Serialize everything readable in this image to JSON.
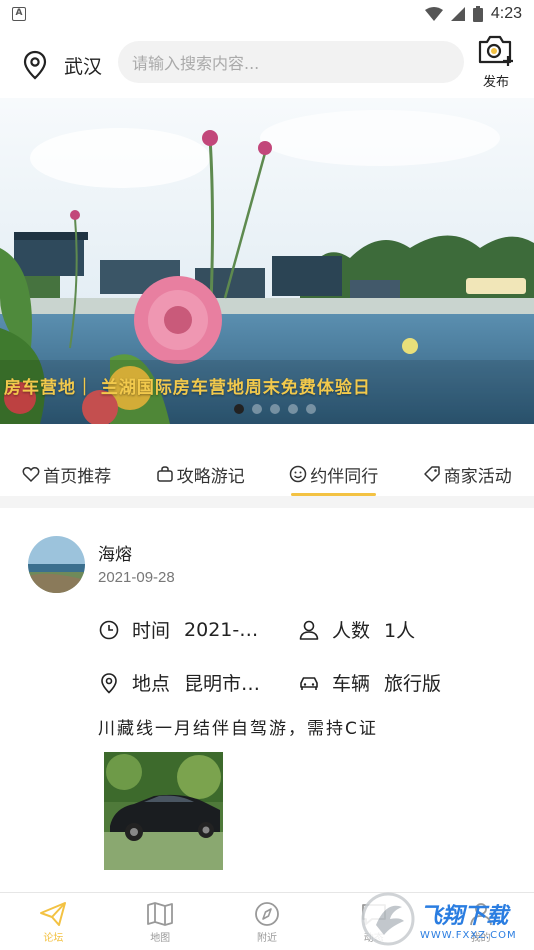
{
  "status_bar": {
    "time": "4:23",
    "left_badge": "A"
  },
  "header": {
    "city": "武汉",
    "search_placeholder": "请输入搜索内容...",
    "publish_label": "发布"
  },
  "banner": {
    "caption": "房车营地｜ 兰湖国际房车营地周末免费体验日",
    "page_count": 5,
    "active_page": 1
  },
  "tabs": [
    {
      "label": "首页推荐",
      "icon": "heart-icon",
      "active": false
    },
    {
      "label": "攻略游记",
      "icon": "bag-icon",
      "active": false
    },
    {
      "label": "约伴同行",
      "icon": "smile-icon",
      "active": true
    },
    {
      "label": "商家活动",
      "icon": "tag-icon",
      "active": false
    }
  ],
  "post": {
    "author": "海熔",
    "date": "2021-09-28",
    "time_label": "时间",
    "time_value": "2021-…",
    "people_label": "人数",
    "people_value": "1人",
    "place_label": "地点",
    "place_value": "昆明市…",
    "vehicle_label": "车辆",
    "vehicle_value": "旅行版",
    "description": "川藏线一月结伴自驾游，需持C证"
  },
  "bottom_nav": [
    {
      "label": "论坛",
      "icon": "paper-plane-icon",
      "active": true
    },
    {
      "label": "地图",
      "icon": "map-icon",
      "active": false
    },
    {
      "label": "附近",
      "icon": "compass-icon",
      "active": false
    },
    {
      "label": "动态",
      "icon": "message-icon",
      "active": false
    },
    {
      "label": "我的",
      "icon": "user-icon",
      "active": false
    }
  ],
  "watermark": {
    "brand": "飞翔下载",
    "url": "WWW.FXXZ.COM"
  },
  "colors": {
    "accent": "#f3c243",
    "text": "#222222",
    "muted": "#999999"
  }
}
